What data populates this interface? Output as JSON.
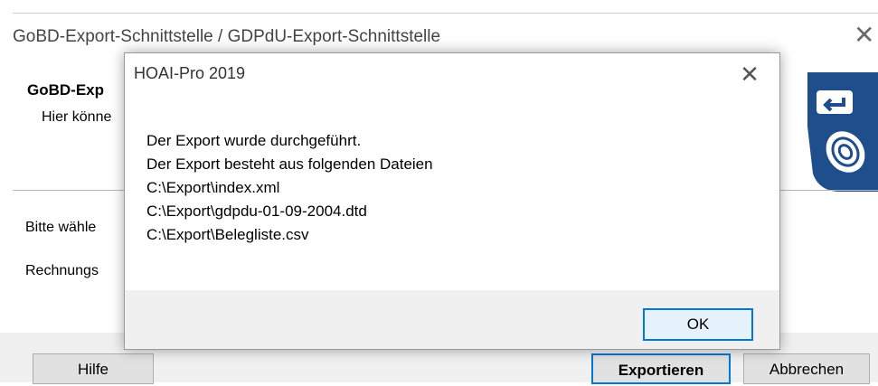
{
  "background_window": {
    "title": "GoBD-Export-Schnittstelle / GDPdU-Export-Schnittstelle",
    "close_glyph": "✕",
    "header": {
      "heading": "GoBD-Exp",
      "description": "Hier könne"
    },
    "logo_icon": "keyboard-enter-hand-icon",
    "prompt": "Bitte wähle",
    "field_label": "Rechnungs",
    "buttons": {
      "help": "Hilfe",
      "export": "Exportieren",
      "cancel": "Abbrechen"
    }
  },
  "dialog": {
    "title": "HOAI-Pro 2019",
    "close_glyph": "✕",
    "message_lines": [
      "Der Export wurde durchgeführt.",
      "Der Export besteht aus folgenden Dateien",
      "C:\\Export\\index.xml",
      "C:\\Export\\gdpdu-01-09-2004.dtd",
      "C:\\Export\\Belegliste.csv"
    ],
    "ok_label": "OK"
  },
  "colors": {
    "accent": "#0078d7",
    "logo_blue": "#1f4e8c"
  }
}
